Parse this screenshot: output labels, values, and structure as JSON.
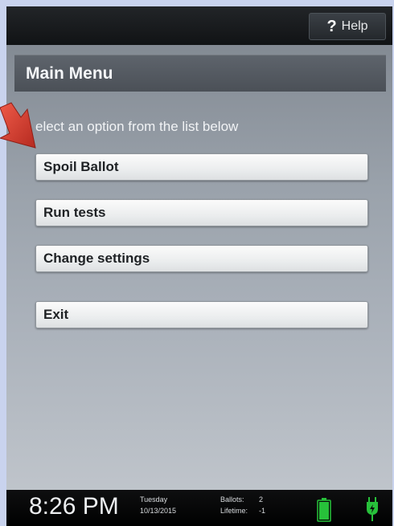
{
  "header": {
    "help_label": "Help",
    "help_icon_glyph": "?",
    "help_icon": "question-mark-icon"
  },
  "main": {
    "title": "Main Menu",
    "instruction": "elect an option from the list below",
    "options": [
      {
        "label": "Spoil Ballot"
      },
      {
        "label": "Run tests"
      },
      {
        "label": "Change settings"
      },
      {
        "label": "Exit"
      }
    ]
  },
  "status_bar": {
    "time": "8:26 PM",
    "day": "Tuesday",
    "date": "10/13/2015",
    "ballots_label": "Ballots:",
    "ballots_value": "2",
    "lifetime_label": "Lifetime:",
    "lifetime_value": "-1",
    "battery_icon": "battery-full-icon",
    "power_icon": "power-plug-icon"
  },
  "overlay": {
    "arrow_icon": "red-arrow-icon"
  },
  "colors": {
    "outer_border": "#c9d3ee",
    "top_bar": "#16181a",
    "title_bar": "#565b62",
    "button_face": "#f0f1f2",
    "battery_green": "#27c13a",
    "arrow_red": "#d8382c"
  }
}
